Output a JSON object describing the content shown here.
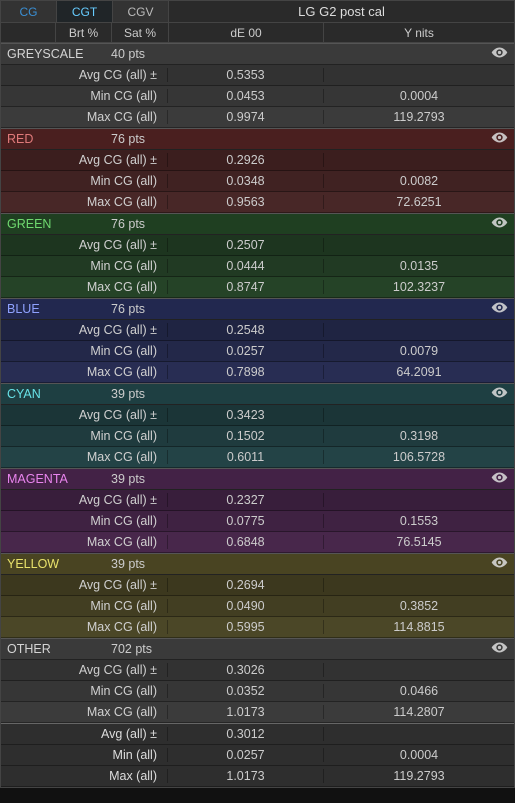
{
  "tabs": {
    "cg": "CG",
    "cgt": "CGT",
    "cgv": "CGV"
  },
  "title": "LG G2 post cal",
  "headers": {
    "brt": "Brt %",
    "sat": "Sat %",
    "de": "dE 00",
    "ynits": "Y nits"
  },
  "row_labels": {
    "avg_cg": "Avg CG (all) ±",
    "min_cg": "Min CG (all)",
    "max_cg": "Max CG (all)",
    "avg_all": "Avg (all) ±",
    "min_all": "Min (all)",
    "max_all": "Max (all)"
  },
  "groups": [
    {
      "key": "greyscale",
      "name": "GREYSCALE",
      "pts": "40 pts",
      "header_color": "#3a3a3a",
      "name_color": "#d4d4d4",
      "row_bgs": [
        "#323232",
        "#363636",
        "#3b3b3b"
      ],
      "rows": [
        {
          "label_key": "avg_cg",
          "de": "0.5353",
          "y": ""
        },
        {
          "label_key": "min_cg",
          "de": "0.0453",
          "y": "0.0004"
        },
        {
          "label_key": "max_cg",
          "de": "0.9974",
          "y": "119.2793"
        }
      ]
    },
    {
      "key": "red",
      "name": "RED",
      "pts": "76 pts",
      "header_color": "#4a1f1f",
      "name_color": "#e07a7a",
      "row_bgs": [
        "#3b1e1e",
        "#402222",
        "#482727"
      ],
      "rows": [
        {
          "label_key": "avg_cg",
          "de": "0.2926",
          "y": ""
        },
        {
          "label_key": "min_cg",
          "de": "0.0348",
          "y": "0.0082"
        },
        {
          "label_key": "max_cg",
          "de": "0.9563",
          "y": "72.6251"
        }
      ]
    },
    {
      "key": "green",
      "name": "GREEN",
      "pts": "76 pts",
      "header_color": "#1f3f21",
      "name_color": "#6fd96f",
      "row_bgs": [
        "#1d351f",
        "#213a23",
        "#254327"
      ],
      "rows": [
        {
          "label_key": "avg_cg",
          "de": "0.2507",
          "y": ""
        },
        {
          "label_key": "min_cg",
          "de": "0.0444",
          "y": "0.0135"
        },
        {
          "label_key": "max_cg",
          "de": "0.8747",
          "y": "102.3237"
        }
      ]
    },
    {
      "key": "blue",
      "name": "BLUE",
      "pts": "76 pts",
      "header_color": "#22284f",
      "name_color": "#8fa2ff",
      "row_bgs": [
        "#1f2442",
        "#232849",
        "#282d53"
      ],
      "rows": [
        {
          "label_key": "avg_cg",
          "de": "0.2548",
          "y": ""
        },
        {
          "label_key": "min_cg",
          "de": "0.0257",
          "y": "0.0079"
        },
        {
          "label_key": "max_cg",
          "de": "0.7898",
          "y": "64.2091"
        }
      ]
    },
    {
      "key": "cyan",
      "name": "CYAN",
      "pts": "39 pts",
      "header_color": "#1e3f42",
      "name_color": "#67e1e6",
      "row_bgs": [
        "#1b3537",
        "#1f3b3e",
        "#234346"
      ],
      "rows": [
        {
          "label_key": "avg_cg",
          "de": "0.3423",
          "y": ""
        },
        {
          "label_key": "min_cg",
          "de": "0.1502",
          "y": "0.3198"
        },
        {
          "label_key": "max_cg",
          "de": "0.6011",
          "y": "106.5728"
        }
      ]
    },
    {
      "key": "magenta",
      "name": "MAGENTA",
      "pts": "39 pts",
      "header_color": "#432246",
      "name_color": "#e884ed",
      "row_bgs": [
        "#381e3b",
        "#3f2242",
        "#48274b"
      ],
      "rows": [
        {
          "label_key": "avg_cg",
          "de": "0.2327",
          "y": ""
        },
        {
          "label_key": "min_cg",
          "de": "0.0775",
          "y": "0.1553"
        },
        {
          "label_key": "max_cg",
          "de": "0.6848",
          "y": "76.5145"
        }
      ]
    },
    {
      "key": "yellow",
      "name": "YELLOW",
      "pts": "39 pts",
      "header_color": "#494422",
      "name_color": "#e8e26b",
      "row_bgs": [
        "#3c381e",
        "#423e22",
        "#4b4727"
      ],
      "rows": [
        {
          "label_key": "avg_cg",
          "de": "0.2694",
          "y": ""
        },
        {
          "label_key": "min_cg",
          "de": "0.0490",
          "y": "0.3852"
        },
        {
          "label_key": "max_cg",
          "de": "0.5995",
          "y": "114.8815"
        }
      ]
    },
    {
      "key": "other",
      "name": "OTHER",
      "pts": "702 pts",
      "header_color": "#3a3a3a",
      "name_color": "#d4d4d4",
      "row_bgs": [
        "#323232",
        "#363636",
        "#3b3b3b"
      ],
      "rows": [
        {
          "label_key": "avg_cg",
          "de": "0.3026",
          "y": ""
        },
        {
          "label_key": "min_cg",
          "de": "0.0352",
          "y": "0.0466"
        },
        {
          "label_key": "max_cg",
          "de": "1.0173",
          "y": "114.2807"
        }
      ]
    }
  ],
  "totals": [
    {
      "label_key": "avg_all",
      "de": "0.3012",
      "y": ""
    },
    {
      "label_key": "min_all",
      "de": "0.0257",
      "y": "0.0004"
    },
    {
      "label_key": "max_all",
      "de": "1.0173",
      "y": "119.2793"
    }
  ]
}
